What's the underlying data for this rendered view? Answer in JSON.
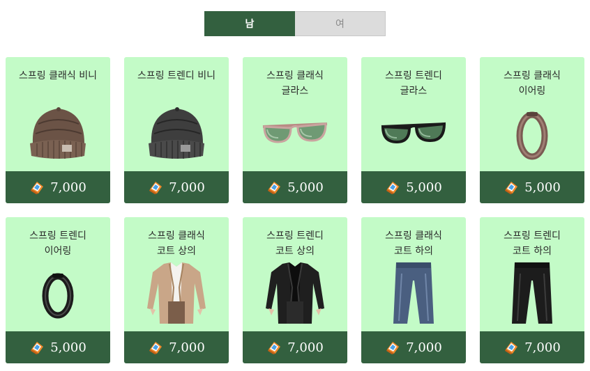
{
  "gender_tabs": [
    {
      "label": "남",
      "active": true
    },
    {
      "label": "여",
      "active": false
    }
  ],
  "items": [
    {
      "name": "스프링 클래식 비니",
      "price": "7,000",
      "icon": "brown-beanie-icon"
    },
    {
      "name": "스프링 트렌디 비니",
      "price": "7,000",
      "icon": "gray-beanie-icon"
    },
    {
      "name": "스프링 클래식\n글라스",
      "price": "5,000",
      "icon": "green-glasses-icon"
    },
    {
      "name": "스프링 트렌디\n글라스",
      "price": "5,000",
      "icon": "black-glasses-icon"
    },
    {
      "name": "스프링 클래식\n이어링",
      "price": "5,000",
      "icon": "bronze-earring-icon"
    },
    {
      "name": "스프링 트렌디\n이어링",
      "price": "5,000",
      "icon": "black-earring-icon"
    },
    {
      "name": "스프링 클래식\n코트 상의",
      "price": "7,000",
      "icon": "beige-coat-icon"
    },
    {
      "name": "스프링 트렌디\n코트 상의",
      "price": "7,000",
      "icon": "black-coat-icon"
    },
    {
      "name": "스프링 클래식\n코트 하의",
      "price": "7,000",
      "icon": "blue-pants-icon"
    },
    {
      "name": "스프링 트렌디\n코트 하의",
      "price": "7,000",
      "icon": "black-pants-icon"
    }
  ],
  "colors": {
    "accent": "#33603f",
    "card_background": "#c3fbc7",
    "inactive_tab": "#dcdcdc"
  }
}
